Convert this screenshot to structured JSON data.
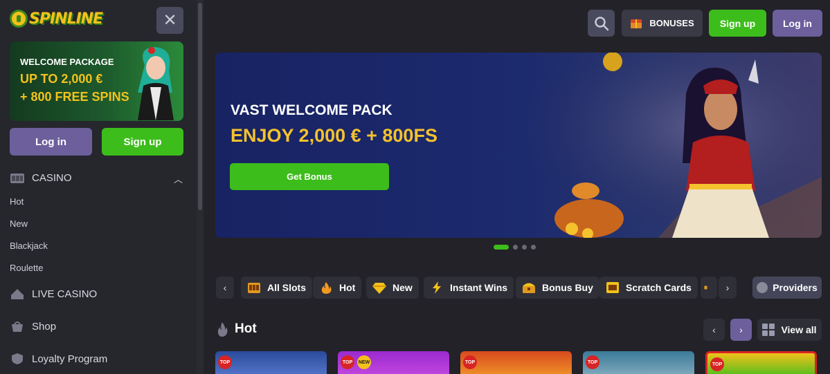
{
  "brand": {
    "name": "SPINLINE"
  },
  "sidebar": {
    "promo": {
      "line1": "WELCOME PACKAGE",
      "line2": "UP TO 2,000 €",
      "line3": "+ 800 FREE SPINS"
    },
    "login_label": "Log in",
    "signup_label": "Sign up",
    "casino": {
      "label": "CASINO",
      "expanded": true,
      "items": [
        "Hot",
        "New",
        "Blackjack",
        "Roulette"
      ]
    },
    "sections": [
      {
        "label": "LIVE CASINO",
        "icon": "live-casino-icon"
      },
      {
        "label": "Shop",
        "icon": "shop-icon"
      },
      {
        "label": "Loyalty Program",
        "icon": "loyalty-icon"
      }
    ]
  },
  "header": {
    "bonuses_label": "BONUSES",
    "signup_label": "Sign up",
    "login_label": "Log in"
  },
  "hero": {
    "title": "VAST WELCOME PACK",
    "subtitle": "ENJOY 2,000 € + 800FS",
    "cta": "Get Bonus",
    "slides": 4,
    "active_slide": 1
  },
  "categories": {
    "items": [
      {
        "label": "All Slots",
        "icon": "slot-machine-icon"
      },
      {
        "label": "Hot",
        "icon": "flame-icon"
      },
      {
        "label": "New",
        "icon": "diamond-icon"
      },
      {
        "label": "Instant Wins",
        "icon": "lightning-icon"
      },
      {
        "label": "Bonus Buy",
        "icon": "chest-icon"
      },
      {
        "label": "Scratch Cards",
        "icon": "scratch-card-icon"
      }
    ],
    "providers_label": "Providers"
  },
  "hot_section": {
    "title": "Hot",
    "view_all": "View all",
    "games": [
      {
        "badges": [
          "TOP"
        ]
      },
      {
        "badges": [
          "TOP",
          "NEW"
        ]
      },
      {
        "badges": [
          "TOP"
        ]
      },
      {
        "badges": [
          "TOP"
        ]
      },
      {
        "badges": [
          "TOP"
        ]
      }
    ]
  },
  "colors": {
    "accent_green": "#3dbd1c",
    "accent_purple": "#6c5f9c",
    "gold": "#f4c22d",
    "bg": "#222228"
  }
}
